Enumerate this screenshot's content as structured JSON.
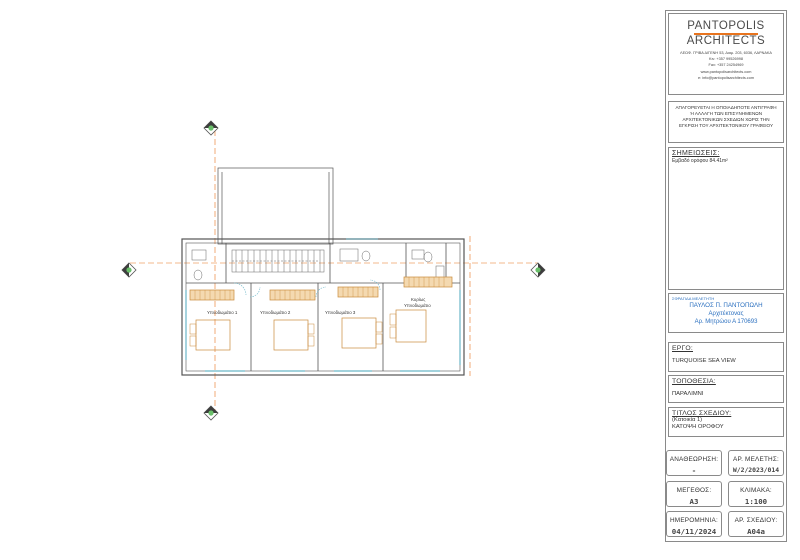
{
  "logo": {
    "line1": "PANTOPOLIS",
    "line2": "ARCHITECTS",
    "address": "ΛΕΩΦ. ΓΡΙΒΑ ΔΙΓΕΝΗ 53, Διαμ. 203, 6036, ΛΑΡΝΑΚΑ",
    "mobile": "Κιν: +357 99526998",
    "fax": "Fax: +357 24254969",
    "web": "www.pantopolisarchitects.com",
    "email": "e: info@pantopolisarchitects.com",
    "accent_color": "#e8741e"
  },
  "warning": "ΑΠΑΓΟΡΕΥΕΤΑΙ Η ΟΠΟΙΑΔΗΠΟΤΕ ΑΝΤΙΓΡΑΦΗ Ή ΑΛΛΑΓΗ ΤΩΝ ΕΠΙΣΥΝΗΜΕΝΩΝ ΑΡΧΙΤΕΚΤΟΝΙΚΩΝ ΣΧΕΔΙΩΝ ΧΩΡΙΣ ΤΗΝ ΕΓΚΡΙΣΗ ΤΟΥ ΑΡΧΙΤΕΚΤΟΝΙΚΟΥ ΓΡΑΦΕΙΟΥ",
  "notes": {
    "title": "ΣΗΜΕΙΩΣΕΙΣ:",
    "text": "Εμβαδό ορόφου 84.41m²"
  },
  "stamp": {
    "heading": "ΣΦΡΑΓΙΔΑ ΜΕΛΕΤΗΤΗ",
    "name": "ΠΑΥΛΟΣ Π. ΠΑΝΤΟΠΩΛΗ",
    "role": "Αρχιτέκτονας",
    "registration": "Αρ. Μητρώου Α 170693",
    "color": "#2a6fbf"
  },
  "project": {
    "label": "ΕΡΓΟ:",
    "value": "TURQUOISE SEA VIEW"
  },
  "location": {
    "label": "ΤΟΠΟΘΕΣΙΑ:",
    "value": "ΠΑΡΑΛΙΜΝΙ"
  },
  "drawing_title": {
    "label": "ΤΙΤΛΟΣ ΣΧΕΔΙΟΥ:",
    "line1": "(Κατοικία 1)",
    "line2": "ΚΑΤΟΨΗ ΟΡΟΦΟΥ"
  },
  "cells": {
    "revision_label": "ΑΝΑΘΕΩΡΗΣΗ:",
    "revision": "-",
    "study_no_label": "ΑΡ. ΜΕΛΕΤΗΣ:",
    "study_no": "W/2/2023/014",
    "size_label": "ΜΕΓΕΘΟΣ:",
    "size": "A3",
    "scale_label": "ΚΛΙΜΑΚΑ:",
    "scale": "1:100",
    "date_label": "ΗΜΕΡΟΜΗΝΙΑ:",
    "date": "04/11/2024",
    "drawing_no_label": "ΑΡ. ΣΧΕΔΙΟΥ:",
    "drawing_no": "A04a"
  },
  "rooms": {
    "bedroom1": "Υπνοδωμάτιο 1",
    "bedroom2": "Υπνοδωμάτιο 2",
    "bedroom3": "Υπνοδωμάτιο 3",
    "master_line1": "Κυρίως",
    "master_line2": "Υπνοδωμάτιο"
  },
  "colors": {
    "furniture": "#c98a3c",
    "axis": "#e8741e",
    "wall": "#555555",
    "glazing": "#6bb6c8"
  }
}
